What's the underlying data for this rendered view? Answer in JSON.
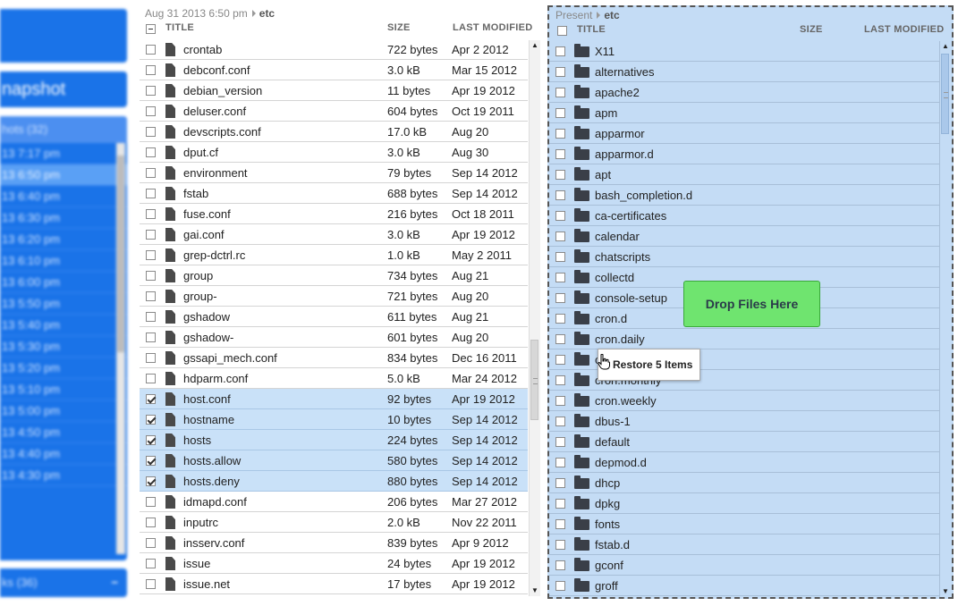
{
  "sidebar": {
    "snapshot_button_label": "napshot",
    "snapshots_header": "hots (32)",
    "snapshots": [
      {
        "label": "13 7:17 pm",
        "selected": false
      },
      {
        "label": "13 6:50 pm",
        "selected": true
      },
      {
        "label": "13 6:40 pm",
        "selected": false
      },
      {
        "label": "13 6:30 pm",
        "selected": false
      },
      {
        "label": "13 6:20 pm",
        "selected": false
      },
      {
        "label": "13 6:10 pm",
        "selected": false
      },
      {
        "label": "13 6:00 pm",
        "selected": false
      },
      {
        "label": "13 5:50 pm",
        "selected": false
      },
      {
        "label": "13 5:40 pm",
        "selected": false
      },
      {
        "label": "13 5:30 pm",
        "selected": false
      },
      {
        "label": "13 5:20 pm",
        "selected": false
      },
      {
        "label": "13 5:10 pm",
        "selected": false
      },
      {
        "label": "13 5:00 pm",
        "selected": false
      },
      {
        "label": "13 4:50 pm",
        "selected": false
      },
      {
        "label": "13 4:40 pm",
        "selected": false
      },
      {
        "label": "13 4:30 pm",
        "selected": false
      }
    ],
    "footer_label": "ks (36)",
    "footer_toggle": "−"
  },
  "left_pane": {
    "breadcrumb_date": "Aug 31 2013 6:50 pm",
    "breadcrumb_folder": "etc",
    "columns": {
      "title": "TITLE",
      "size": "SIZE",
      "modified": "LAST MODIFIED"
    },
    "rows": [
      {
        "name": "crontab",
        "size": "722 bytes",
        "modified": "Apr 2 2012",
        "checked": false
      },
      {
        "name": "debconf.conf",
        "size": "3.0 kB",
        "modified": "Mar 15 2012",
        "checked": false
      },
      {
        "name": "debian_version",
        "size": "11 bytes",
        "modified": "Apr 19 2012",
        "checked": false
      },
      {
        "name": "deluser.conf",
        "size": "604 bytes",
        "modified": "Oct 19 2011",
        "checked": false
      },
      {
        "name": "devscripts.conf",
        "size": "17.0 kB",
        "modified": "Aug 20",
        "checked": false
      },
      {
        "name": "dput.cf",
        "size": "3.0 kB",
        "modified": "Aug 30",
        "checked": false
      },
      {
        "name": "environment",
        "size": "79 bytes",
        "modified": "Sep 14 2012",
        "checked": false
      },
      {
        "name": "fstab",
        "size": "688 bytes",
        "modified": "Sep 14 2012",
        "checked": false
      },
      {
        "name": "fuse.conf",
        "size": "216 bytes",
        "modified": "Oct 18 2011",
        "checked": false
      },
      {
        "name": "gai.conf",
        "size": "3.0 kB",
        "modified": "Apr 19 2012",
        "checked": false
      },
      {
        "name": "grep-dctrl.rc",
        "size": "1.0 kB",
        "modified": "May 2 2011",
        "checked": false
      },
      {
        "name": "group",
        "size": "734 bytes",
        "modified": "Aug 21",
        "checked": false
      },
      {
        "name": "group-",
        "size": "721 bytes",
        "modified": "Aug 20",
        "checked": false
      },
      {
        "name": "gshadow",
        "size": "611 bytes",
        "modified": "Aug 21",
        "checked": false
      },
      {
        "name": "gshadow-",
        "size": "601 bytes",
        "modified": "Aug 20",
        "checked": false
      },
      {
        "name": "gssapi_mech.conf",
        "size": "834 bytes",
        "modified": "Dec 16 2011",
        "checked": false
      },
      {
        "name": "hdparm.conf",
        "size": "5.0 kB",
        "modified": "Mar 24 2012",
        "checked": false
      },
      {
        "name": "host.conf",
        "size": "92 bytes",
        "modified": "Apr 19 2012",
        "checked": true
      },
      {
        "name": "hostname",
        "size": "10 bytes",
        "modified": "Sep 14 2012",
        "checked": true
      },
      {
        "name": "hosts",
        "size": "224 bytes",
        "modified": "Sep 14 2012",
        "checked": true
      },
      {
        "name": "hosts.allow",
        "size": "580 bytes",
        "modified": "Sep 14 2012",
        "checked": true
      },
      {
        "name": "hosts.deny",
        "size": "880 bytes",
        "modified": "Sep 14 2012",
        "checked": true
      },
      {
        "name": "idmapd.conf",
        "size": "206 bytes",
        "modified": "Mar 27 2012",
        "checked": false
      },
      {
        "name": "inputrc",
        "size": "2.0 kB",
        "modified": "Nov 22 2011",
        "checked": false
      },
      {
        "name": "insserv.conf",
        "size": "839 bytes",
        "modified": "Apr 9 2012",
        "checked": false
      },
      {
        "name": "issue",
        "size": "24 bytes",
        "modified": "Apr 19 2012",
        "checked": false
      },
      {
        "name": "issue.net",
        "size": "17 bytes",
        "modified": "Apr 19 2012",
        "checked": false
      }
    ]
  },
  "right_pane": {
    "breadcrumb_root": "Present",
    "breadcrumb_folder": "etc",
    "columns": {
      "title": "TITLE",
      "size": "SIZE",
      "modified": "LAST MODIFIED"
    },
    "rows": [
      "X11",
      "alternatives",
      "apache2",
      "apm",
      "apparmor",
      "apparmor.d",
      "apt",
      "bash_completion.d",
      "ca-certificates",
      "calendar",
      "chatscripts",
      "collectd",
      "console-setup",
      "cron.d",
      "cron.daily",
      "cron.hourly",
      "cron.monthly",
      "cron.weekly",
      "dbus-1",
      "default",
      "depmod.d",
      "dhcp",
      "dpkg",
      "fonts",
      "fstab.d",
      "gconf",
      "groff"
    ]
  },
  "drop_target_label": "Drop Files Here",
  "drag_tooltip_label": "Restore 5 Items",
  "colors": {
    "accent": "#1a73e8",
    "selection": "#c9e1f8",
    "drop_zone": "#c4dcf5",
    "drop_button": "#6fe46f"
  }
}
